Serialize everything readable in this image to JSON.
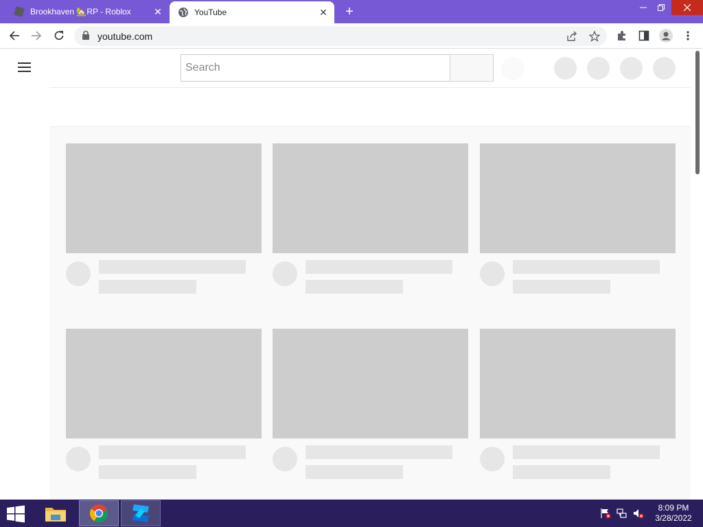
{
  "browser": {
    "tabs": [
      {
        "title": "Brookhaven 🏡RP - Roblox",
        "active": false,
        "favicon": "roblox-icon"
      },
      {
        "title": "YouTube",
        "active": true,
        "favicon": "globe-icon"
      }
    ],
    "url": "youtube.com"
  },
  "youtube": {
    "search_placeholder": "Search",
    "video_placeholders": 6
  },
  "taskbar": {
    "apps": [
      "file-explorer-icon",
      "chrome-icon",
      "roblox-studio-icon"
    ],
    "time": "8:09 PM",
    "date": "3/28/2022"
  },
  "colors": {
    "tabbar": "#7659d4",
    "taskbar": "#2a1f5c",
    "skeleton": "#cdcdcd",
    "close_button": "#c42b1c"
  }
}
